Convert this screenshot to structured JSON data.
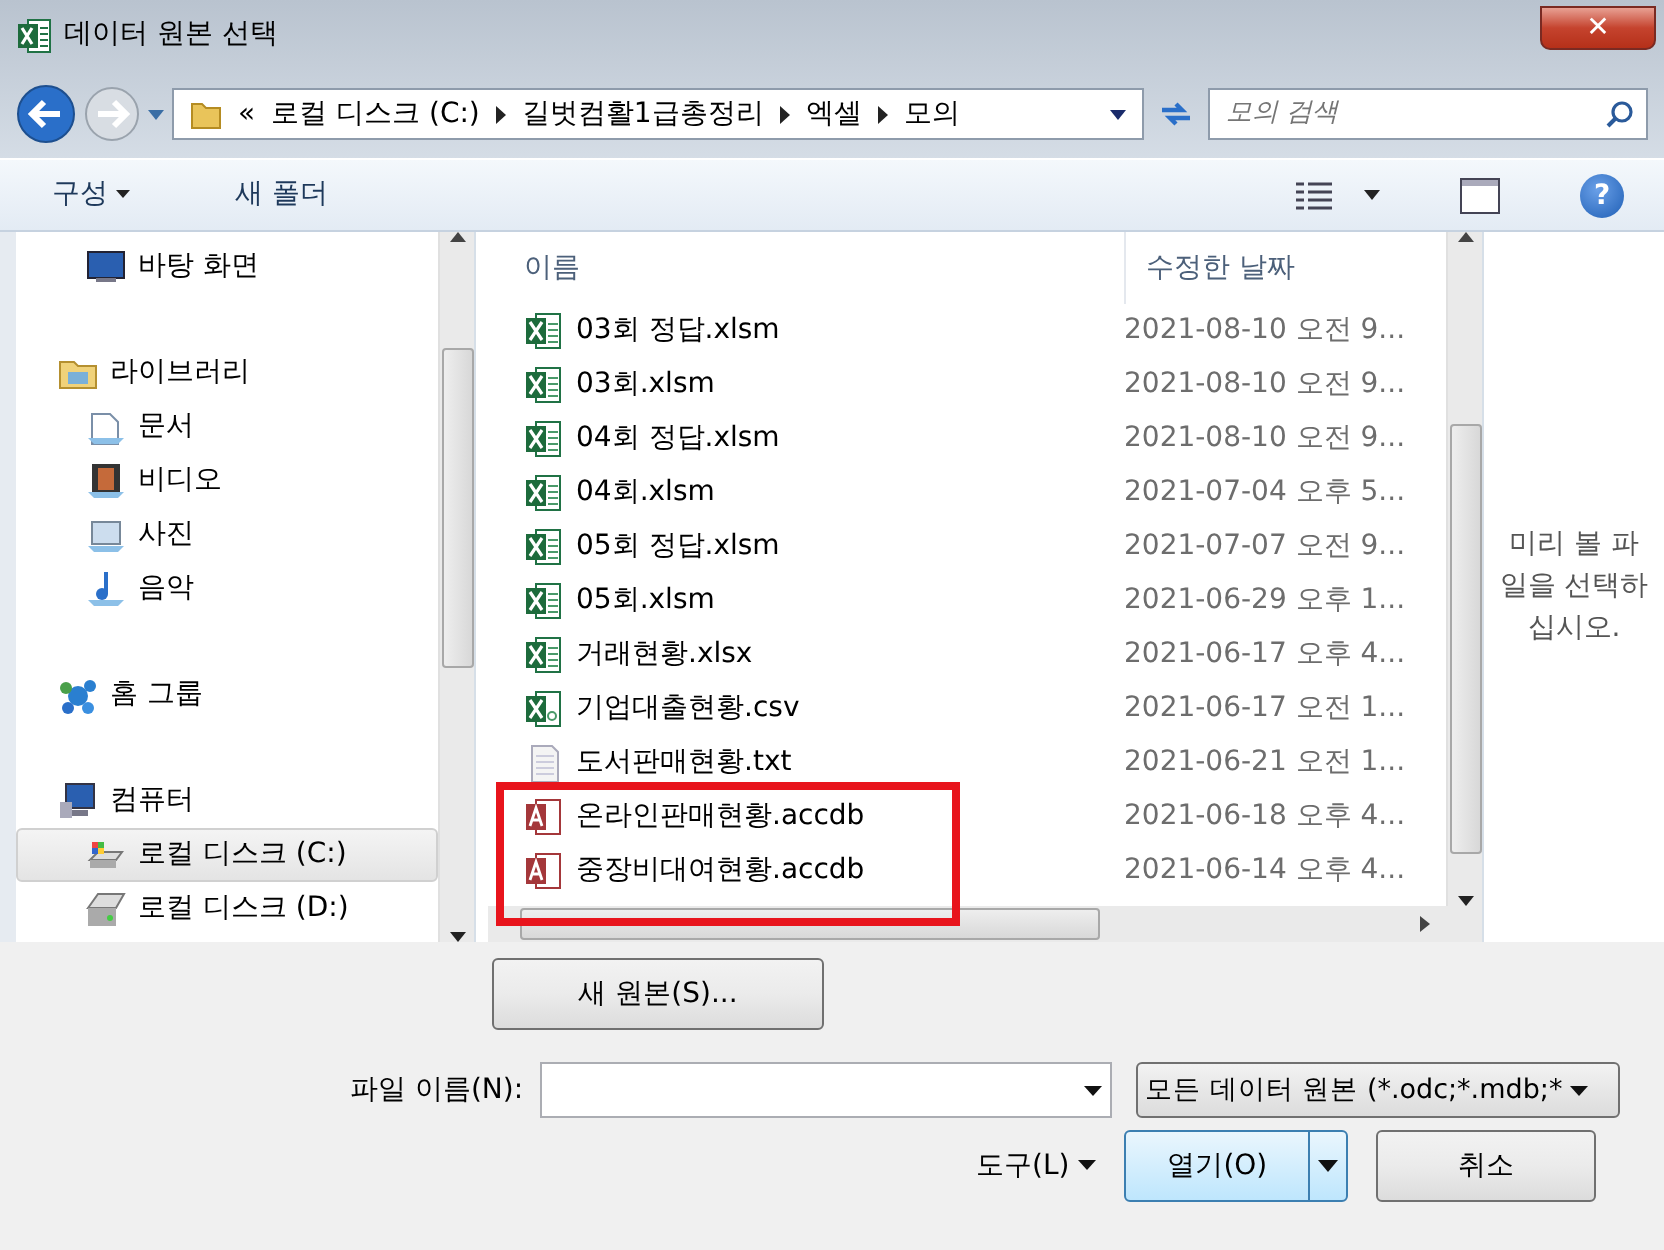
{
  "window": {
    "title": "데이터 원본 선택",
    "close": "✕"
  },
  "address": {
    "overflow": "«",
    "crumbs": [
      "로컬 디스크 (C:)",
      "길벗컴활1급총정리",
      "엑셀",
      "모의"
    ],
    "search_placeholder": "모의 검색"
  },
  "toolbar": {
    "organize": "구성",
    "new_folder": "새 폴더",
    "help": "?"
  },
  "nav": [
    {
      "label": "바탕 화면",
      "kind": "desktop",
      "selected": false
    },
    {
      "label": "라이브러리",
      "kind": "library",
      "selected": false,
      "children": [
        {
          "label": "문서",
          "kind": "documents",
          "selected": false
        },
        {
          "label": "비디오",
          "kind": "video",
          "selected": false
        },
        {
          "label": "사진",
          "kind": "pictures",
          "selected": false
        },
        {
          "label": "음악",
          "kind": "music",
          "selected": false
        }
      ]
    },
    {
      "label": "홈 그룹",
      "kind": "homegroup",
      "selected": false
    },
    {
      "label": "컴퓨터",
      "kind": "computer",
      "selected": false,
      "children": [
        {
          "label": "로컬 디스크 (C:)",
          "kind": "drive_c",
          "selected": true
        },
        {
          "label": "로컬 디스크 (D:)",
          "kind": "drive",
          "selected": false
        }
      ]
    }
  ],
  "columns": [
    "이름",
    "수정한 날짜"
  ],
  "files": [
    {
      "name": "03회 정답.xlsm",
      "date": "2021-08-10 오전 9...",
      "kind": "excel",
      "highlighted": false
    },
    {
      "name": "03회.xlsm",
      "date": "2021-08-10 오전 9...",
      "kind": "excel",
      "highlighted": false
    },
    {
      "name": "04회 정답.xlsm",
      "date": "2021-08-10 오전 9...",
      "kind": "excel",
      "highlighted": false
    },
    {
      "name": "04회.xlsm",
      "date": "2021-07-04 오후 5...",
      "kind": "excel",
      "highlighted": false
    },
    {
      "name": "05회 정답.xlsm",
      "date": "2021-07-07 오전 9...",
      "kind": "excel",
      "highlighted": false
    },
    {
      "name": "05회.xlsm",
      "date": "2021-06-29 오후 1...",
      "kind": "excel",
      "highlighted": false
    },
    {
      "name": "거래현황.xlsx",
      "date": "2021-06-17 오후 4...",
      "kind": "excel",
      "highlighted": false
    },
    {
      "name": "기업대출현황.csv",
      "date": "2021-06-17 오전 1...",
      "kind": "csv",
      "highlighted": false
    },
    {
      "name": "도서판매현황.txt",
      "date": "2021-06-21 오전 1...",
      "kind": "text",
      "highlighted": false
    },
    {
      "name": "온라인판매현황.accdb",
      "date": "2021-06-18 오후 4...",
      "kind": "access",
      "highlighted": true
    },
    {
      "name": "중장비대여현황.accdb",
      "date": "2021-06-14 오후 4...",
      "kind": "access",
      "highlighted": true
    }
  ],
  "preview": "미리 볼 파일을 선택하십시오.",
  "new_source": "새 원본(S)...",
  "file_name": {
    "label": "파일 이름(N):"
  },
  "filter": "모든 데이터 원본 (*.odc;*.mdb;*",
  "tools": "도구(L)",
  "open": "열기(O)",
  "cancel": "취소"
}
